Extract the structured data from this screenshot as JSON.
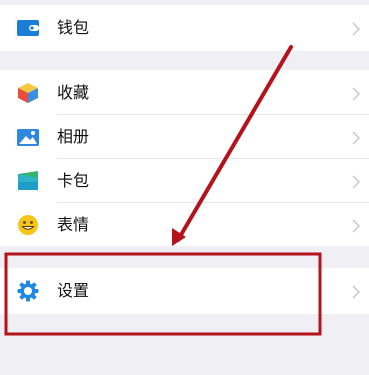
{
  "menu": {
    "wallet": {
      "label": "钱包"
    },
    "favorites": {
      "label": "收藏"
    },
    "album": {
      "label": "相册"
    },
    "cards": {
      "label": "卡包"
    },
    "stickers": {
      "label": "表情"
    },
    "settings": {
      "label": "设置"
    }
  },
  "colors": {
    "background": "#efeff4",
    "annotation": "#b5121b",
    "wallet": "#1a7dd7",
    "settings": "#1e88e5"
  },
  "icons": {
    "wallet": "wallet-icon",
    "favorites": "favorites-cube-icon",
    "album": "photo-album-icon",
    "cards": "card-wallet-icon",
    "stickers": "smiley-face-icon",
    "settings": "gear-icon",
    "chevron": "chevron-right-icon"
  }
}
